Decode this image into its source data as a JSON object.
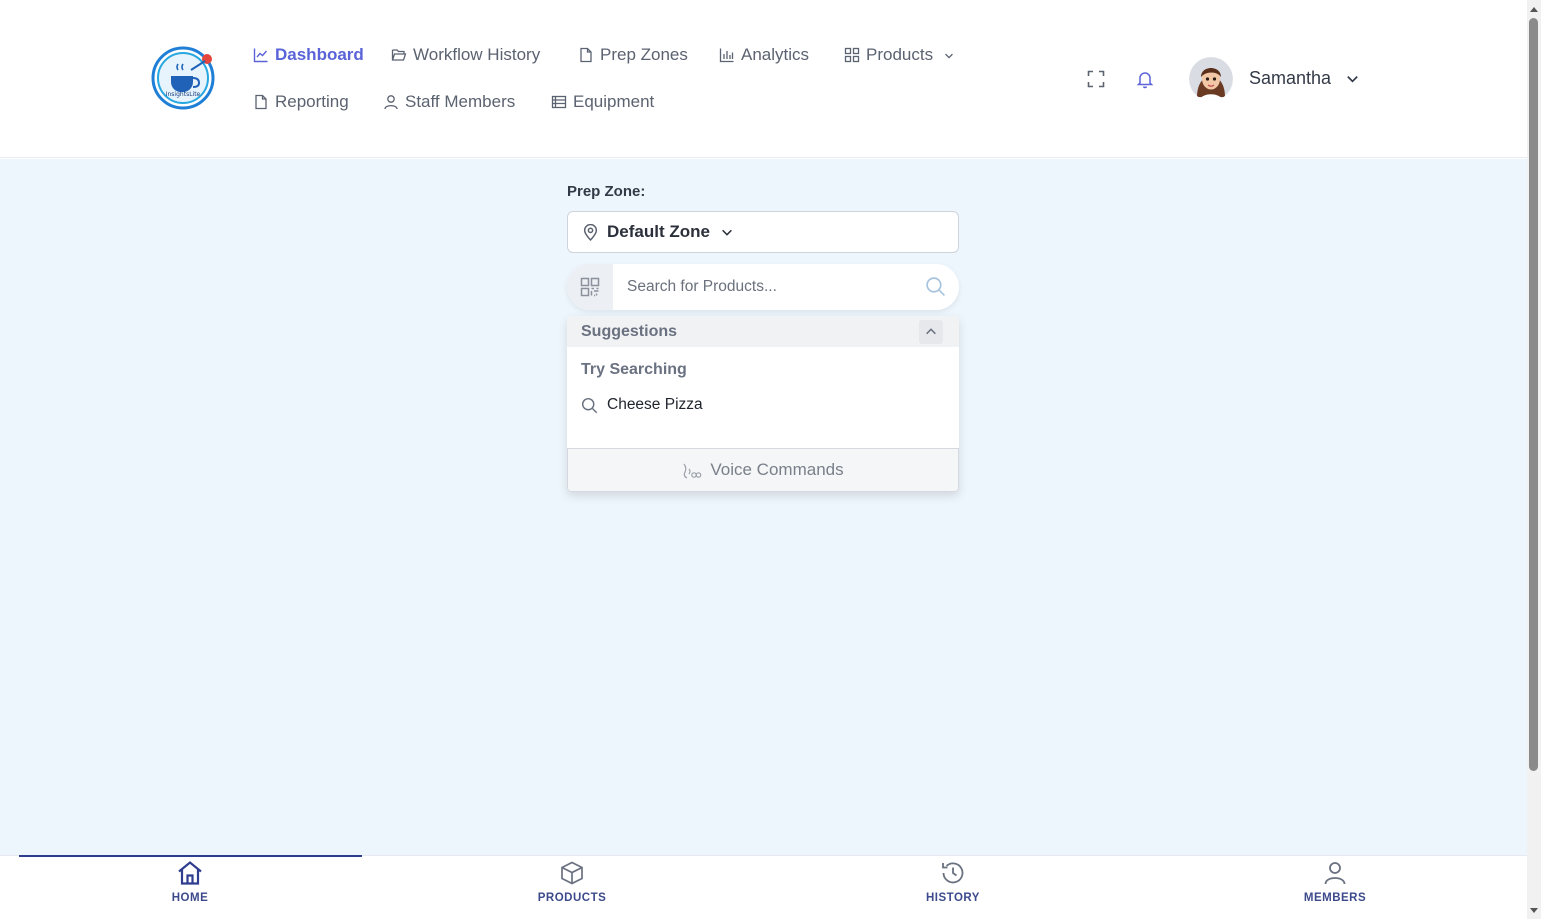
{
  "header": {
    "logo_text": "InsightsLite",
    "nav": [
      {
        "label": "Dashboard",
        "icon": "chart-line-icon",
        "active": true
      },
      {
        "label": "Workflow History",
        "icon": "folder-open-icon"
      },
      {
        "label": "Prep Zones",
        "icon": "file-icon"
      },
      {
        "label": "Analytics",
        "icon": "bar-chart-icon"
      },
      {
        "label": "Products",
        "icon": "grid-icon"
      },
      {
        "label": "Reporting",
        "icon": "file-icon"
      },
      {
        "label": "Staff Members",
        "icon": "user-icon"
      },
      {
        "label": "Equipment",
        "icon": "list-icon"
      }
    ],
    "user": {
      "name": "Samantha"
    }
  },
  "main": {
    "prep_zone_label": "Prep Zone:",
    "zone_value": "Default Zone",
    "search": {
      "placeholder": "Search for Products..."
    },
    "suggestions": {
      "title": "Suggestions",
      "try_label": "Try Searching",
      "items": [
        "Cheese Pizza"
      ],
      "voice_label": "Voice Commands"
    }
  },
  "bottom_nav": [
    {
      "label": "HOME",
      "icon": "home-icon",
      "active": true
    },
    {
      "label": "PRODUCTS",
      "icon": "box-icon"
    },
    {
      "label": "HISTORY",
      "icon": "history-icon"
    },
    {
      "label": "MEMBERS",
      "icon": "user-icon"
    }
  ],
  "colors": {
    "accent": "#5a63d8",
    "bottom_nav": "#3c4a8c",
    "main_bg": "#eef6fd"
  }
}
